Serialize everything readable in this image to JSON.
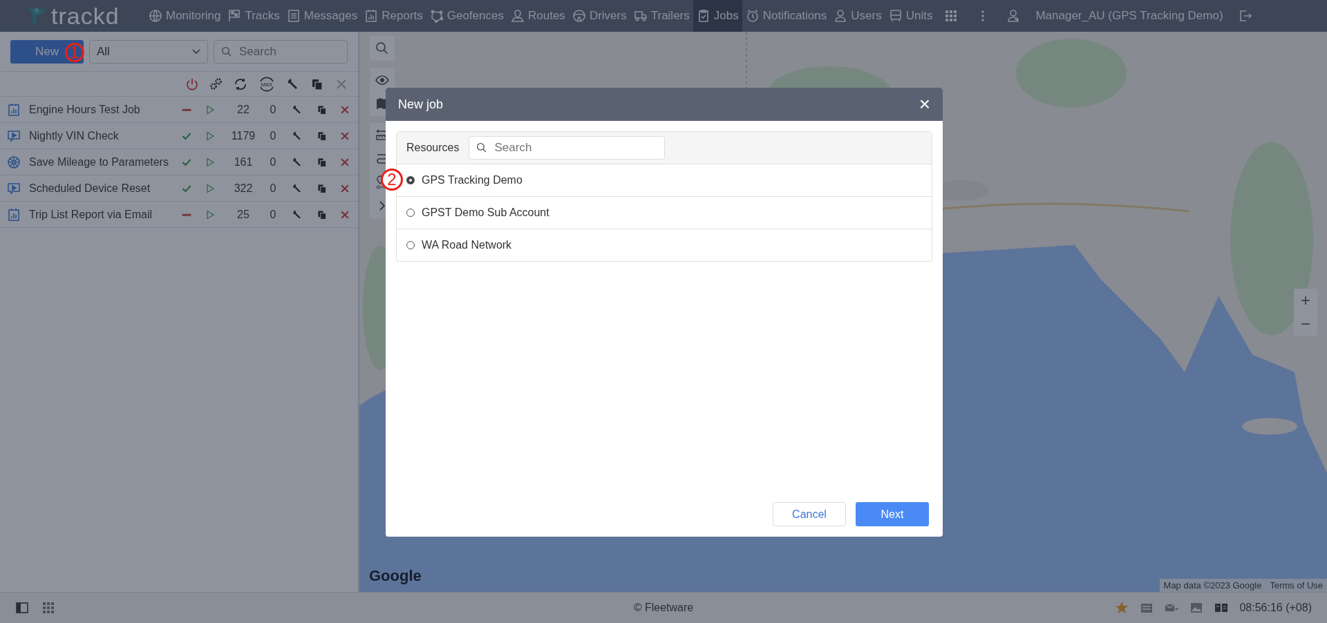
{
  "nav": {
    "logo": "trackd",
    "items": [
      {
        "label": "Monitoring",
        "selected": false
      },
      {
        "label": "Tracks",
        "selected": false
      },
      {
        "label": "Messages",
        "selected": false
      },
      {
        "label": "Reports",
        "selected": false
      },
      {
        "label": "Geofences",
        "selected": false
      },
      {
        "label": "Routes",
        "selected": false
      },
      {
        "label": "Drivers",
        "selected": false
      },
      {
        "label": "Trailers",
        "selected": false
      },
      {
        "label": "Jobs",
        "selected": true
      },
      {
        "label": "Notifications",
        "selected": false
      },
      {
        "label": "Users",
        "selected": false
      },
      {
        "label": "Units",
        "selected": false
      }
    ],
    "user": "Manager_AU (GPS Tracking Demo)"
  },
  "jobs": {
    "new_button": "New",
    "filter": "All",
    "search": {
      "placeholder": "Search"
    },
    "max_label": "MAX",
    "rows": [
      {
        "name": "Engine Hours Test Job",
        "kind": "report",
        "active": false,
        "count": "22",
        "column_5": "0"
      },
      {
        "name": "Nightly VIN Check",
        "kind": "command",
        "active": true,
        "count": "1179",
        "column_5": "0"
      },
      {
        "name": "Save Mileage to Parameters",
        "kind": "parameters",
        "active": true,
        "count": "161",
        "column_5": "0"
      },
      {
        "name": "Scheduled Device Reset",
        "kind": "command",
        "active": true,
        "count": "322",
        "column_5": "0"
      },
      {
        "name": "Trip List Report via Email",
        "kind": "report",
        "active": false,
        "count": "25",
        "column_5": "0"
      }
    ]
  },
  "map": {
    "logo": "Google",
    "attribution": "Map data ©2023 Google",
    "terms": "Terms of Use",
    "zoom_in": "+",
    "zoom_out": "−"
  },
  "dialog": {
    "title": "New job",
    "close": "×",
    "resources_label": "Resources",
    "search": {
      "placeholder": "Search"
    },
    "resources": [
      {
        "label": "GPS Tracking Demo",
        "selected": true
      },
      {
        "label": "GPST Demo Sub Account",
        "selected": false
      },
      {
        "label": "WA Road Network",
        "selected": false
      }
    ],
    "cancel": "Cancel",
    "next": "Next"
  },
  "annotations": [
    {
      "text": "1"
    },
    {
      "text": "2"
    }
  ],
  "status_bar": {
    "copyright": "© Fleetware",
    "time": "08:56:16 (+08)"
  }
}
